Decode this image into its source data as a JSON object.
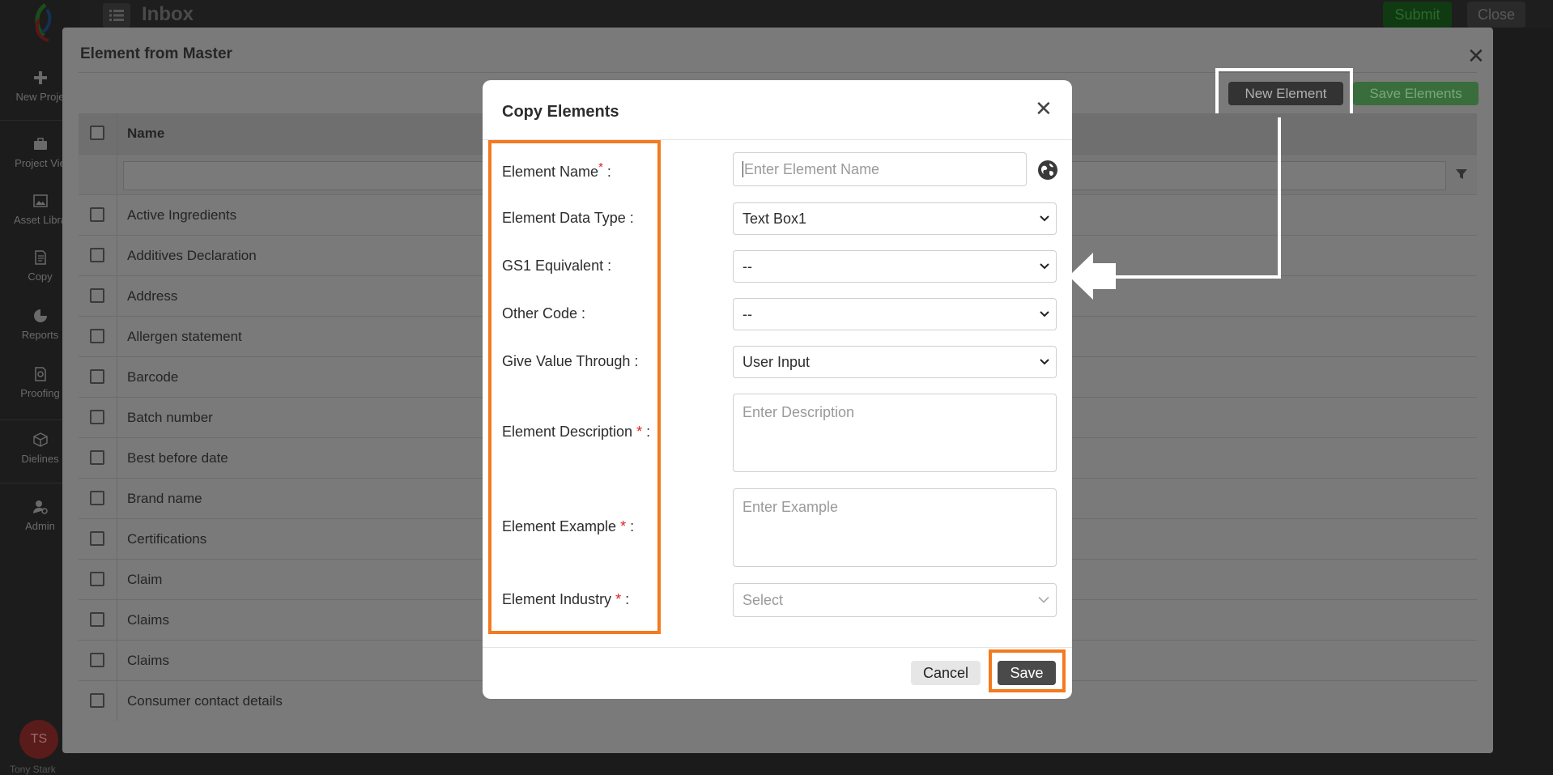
{
  "sidebar": {
    "items": [
      {
        "label": "New Proje",
        "icon": "plus-icon"
      },
      {
        "label": "Project Vie",
        "icon": "briefcase-icon"
      },
      {
        "label": "Asset Libra",
        "icon": "image-icon"
      },
      {
        "label": "Copy",
        "icon": "document-icon"
      },
      {
        "label": "Reports",
        "icon": "pie-chart-icon"
      },
      {
        "label": "Proofing",
        "icon": "proof-search-icon"
      },
      {
        "label": "Dielines",
        "icon": "box-icon"
      },
      {
        "label": "Admin",
        "icon": "user-gear-icon"
      }
    ],
    "avatar_initials": "TS",
    "avatar_name": "Tony Stark"
  },
  "topbar": {
    "title": "Inbox",
    "submit_label": "Submit",
    "close_label": "Close"
  },
  "master": {
    "title": "Element from Master",
    "new_element_label": "New Element",
    "save_elements_label": "Save Elements",
    "column_header": "Name",
    "rows": [
      "Active Ingredients",
      "Additives Declaration",
      "Address",
      "Allergen statement",
      "Barcode",
      "Batch number",
      "Best before date",
      "Brand name",
      "Certifications",
      "Claim",
      "Claims",
      "Claims",
      "Consumer contact details"
    ]
  },
  "dialog": {
    "title": "Copy Elements",
    "fields": {
      "element_name": {
        "label": "Element Name",
        "required": "*",
        "suffix": " :",
        "placeholder": "Enter Element Name"
      },
      "data_type": {
        "label": "Element Data Type :",
        "value": "Text Box1"
      },
      "gs1": {
        "label": "GS1 Equivalent :",
        "value": "--"
      },
      "other_code": {
        "label": "Other Code :",
        "value": "--"
      },
      "value_through": {
        "label": "Give Value Through :",
        "value": "User Input"
      },
      "description": {
        "label": "Element Description ",
        "required": "*",
        "suffix": " :",
        "placeholder": "Enter Description"
      },
      "example": {
        "label": "Element Example ",
        "required": "*",
        "suffix": " :",
        "placeholder": "Enter Example"
      },
      "industry": {
        "label": "Element Industry ",
        "required": "*",
        "suffix": " :",
        "placeholder": "Select"
      }
    },
    "cancel_label": "Cancel",
    "save_label": "Save"
  },
  "colors": {
    "highlight": "#f47a20",
    "required": "#e02020",
    "annotation": "#ffffff"
  }
}
